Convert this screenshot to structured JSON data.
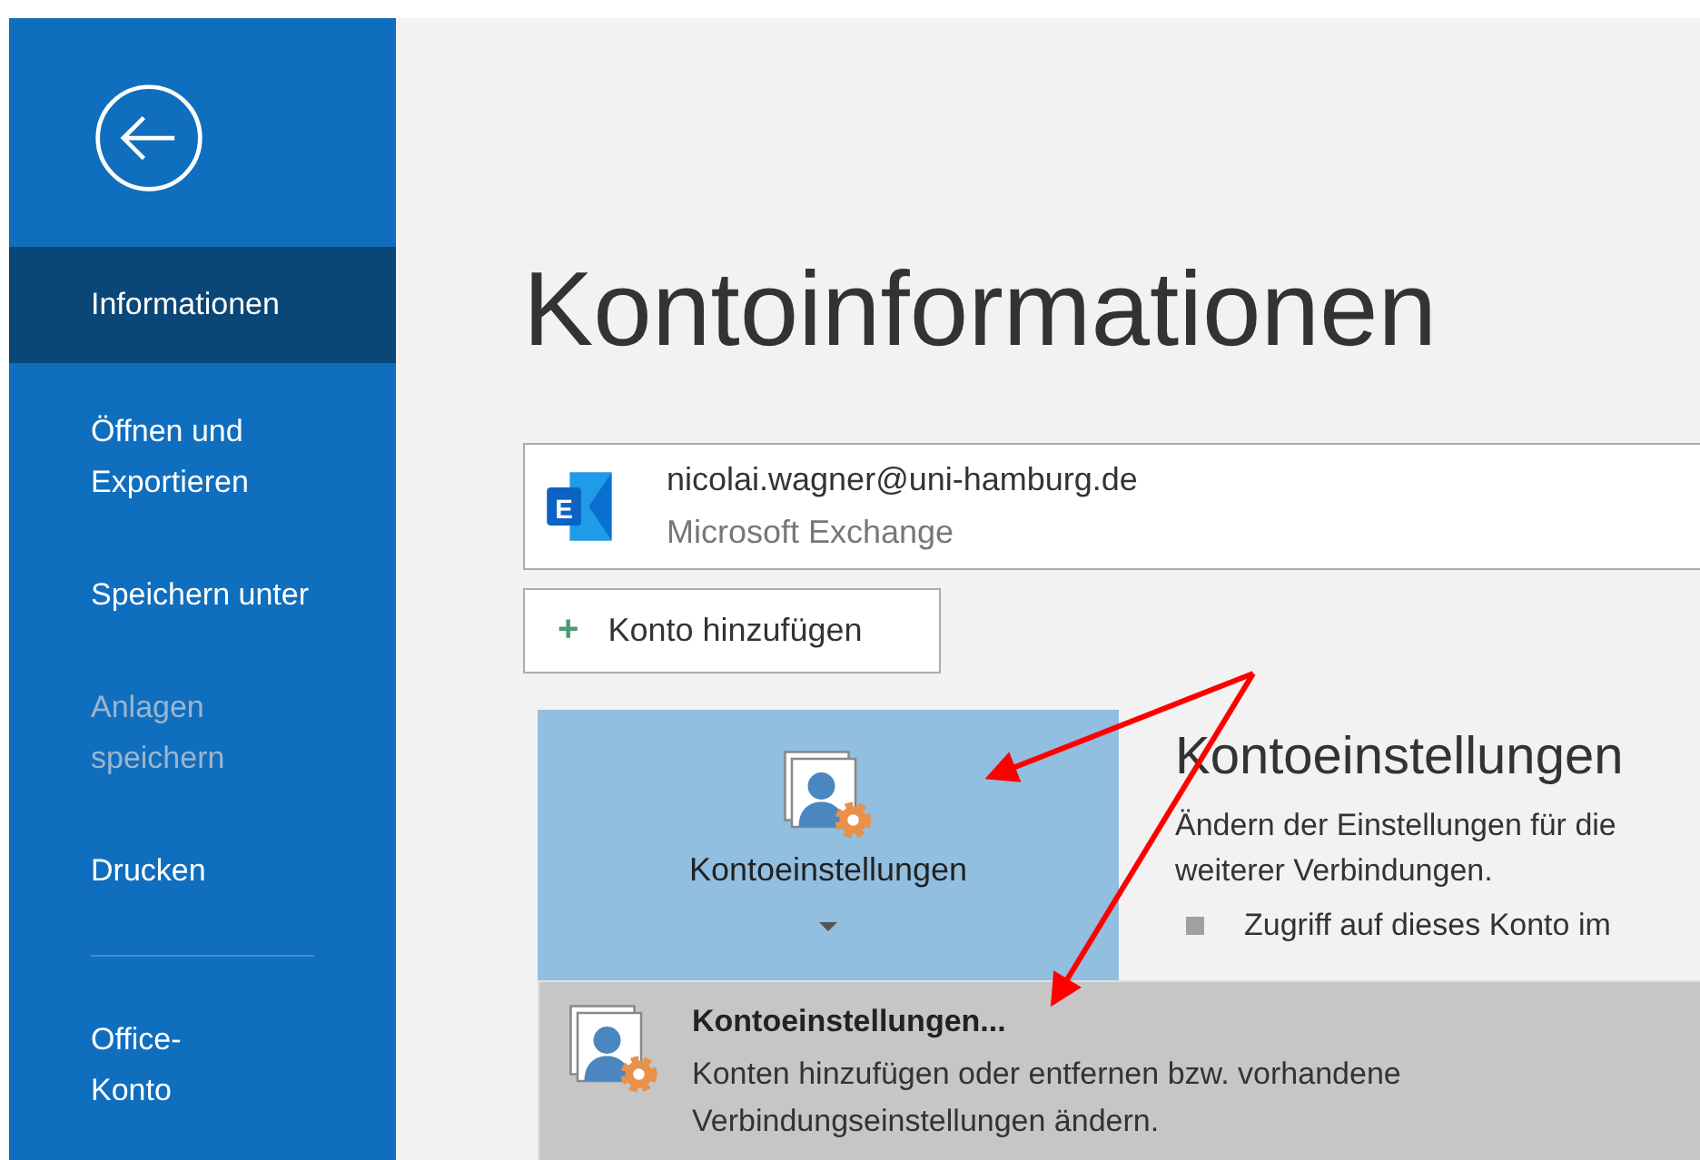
{
  "sidebar": {
    "items": [
      {
        "label": "Informationen",
        "selected": true,
        "disabled": false
      },
      {
        "label": "Öffnen und Exportieren",
        "selected": false,
        "disabled": false
      },
      {
        "label": "Speichern unter",
        "selected": false,
        "disabled": false
      },
      {
        "label": "Anlagen speichern",
        "selected": false,
        "disabled": true
      },
      {
        "label": "Drucken",
        "selected": false,
        "disabled": false
      }
    ],
    "bottom_items": [
      {
        "label": "Office-Konto",
        "selected": false,
        "disabled": false
      }
    ]
  },
  "title": "Kontoinformationen",
  "account": {
    "logo_letter": "E",
    "email": "nicolai.wagner@uni-hamburg.de",
    "type": "Microsoft Exchange"
  },
  "add_account_button": {
    "icon": "+",
    "label": "Konto hinzufügen"
  },
  "account_settings": {
    "button_label": "Kontoeinstellungen",
    "heading": "Kontoeinstellungen",
    "description": "Ändern der Einstellungen für die\nweiterer Verbindungen.",
    "bullets": [
      "Zugriff auf dieses Konto im"
    ]
  },
  "dropdown": {
    "items": [
      {
        "title": "Kontoeinstellungen...",
        "description": "Konten hinzufügen oder entfernen bzw. vorhandene Verbindungseinstellungen ändern."
      }
    ]
  }
}
